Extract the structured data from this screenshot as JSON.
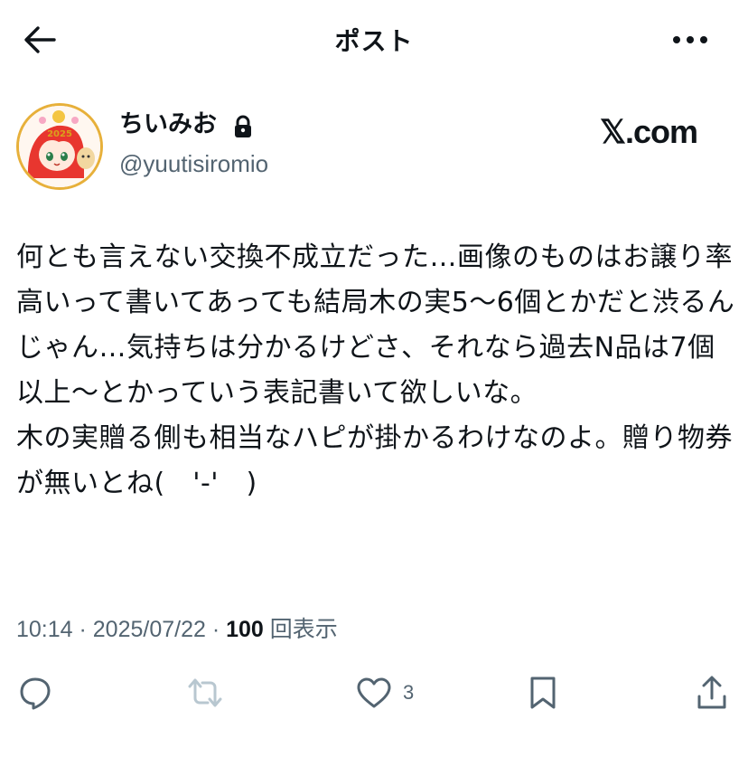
{
  "header": {
    "title": "ポスト",
    "back_icon": "arrow-left-icon",
    "more_icon": "more-horizontal-icon"
  },
  "author": {
    "display_name": "ちいみお",
    "handle": "@yuutisiromio",
    "protected_icon": "lock-icon",
    "avatar_icon": "anime-avatar",
    "avatar_text": "2025"
  },
  "watermark": "𝕏.com",
  "post": {
    "text": "何とも言えない交換不成立だった…画像のものはお譲り率高いって書いてあっても結局木の実5〜6個とかだと渋るんじゃん…気持ちは分かるけどさ、それなら過去N品は7個以上〜とかっていう表記書いて欲しいな。\n木の実贈る側も相当なハピが掛かるわけなのよ。贈り物券が無いとね(　'-'　)"
  },
  "meta": {
    "time": "10:14",
    "sep1": " · ",
    "date": "2025/07/22",
    "sep2": " · ",
    "views_count": "100",
    "views_label": " 回表示"
  },
  "actions": {
    "reply_icon": "reply-icon",
    "repost_icon": "repost-icon",
    "like_icon": "heart-icon",
    "like_count": "3",
    "bookmark_icon": "bookmark-icon",
    "share_icon": "share-icon"
  },
  "colors": {
    "text": "#0f1419",
    "secondary": "#536471",
    "repost_disabled": "#b8c7d0",
    "avatar_ring": "#e7b03a"
  }
}
